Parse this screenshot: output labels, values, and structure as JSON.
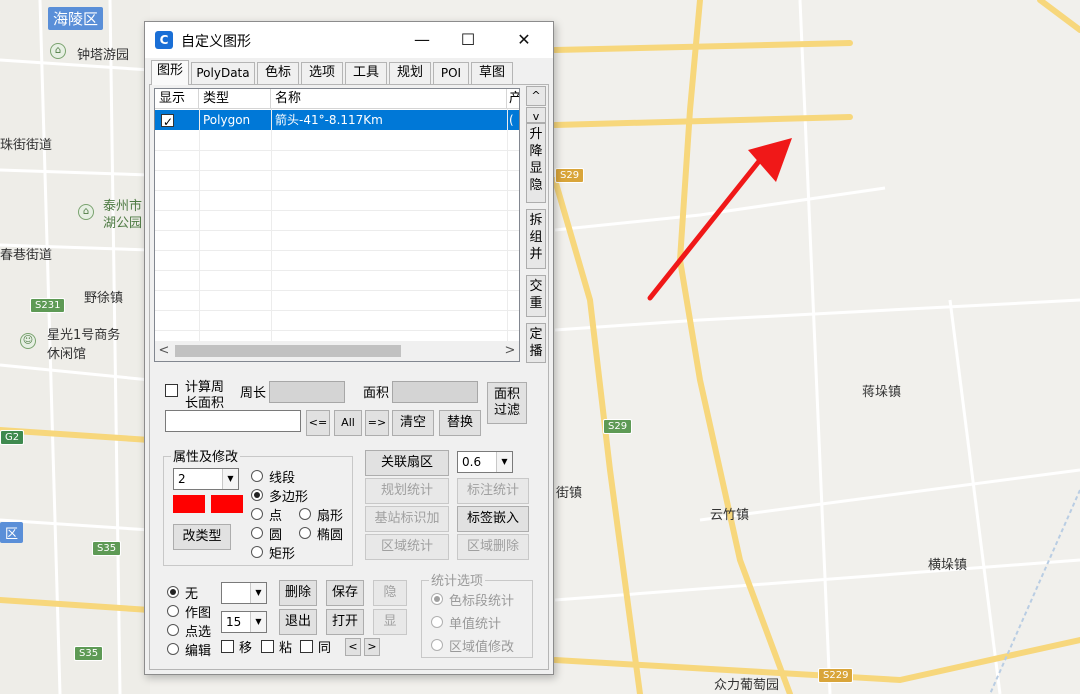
{
  "map": {
    "labels": {
      "haling": "海陵区",
      "tower_park": "钟塔游园",
      "zhujie": "珠街街道",
      "taizhou_park_a": "泰州市",
      "taizhou_park_b": "湖公园",
      "chunxiang": "春巷街道",
      "yexu": "野徐镇",
      "xingguang_a": "星光1号商务",
      "xingguang_b": "休闲馆",
      "jiangduo": "蒋垛镇",
      "yunzhu": "云竹镇",
      "hengduo": "横垛镇",
      "zhongli": "众力葡萄园",
      "town_fragment": "街镇",
      "qu": "区"
    },
    "shields": {
      "s231": "S231",
      "s29a": "S29",
      "s29b": "S29",
      "g2": "G2",
      "s35a": "S35",
      "s35b": "S35",
      "s229": "S229"
    },
    "colors": {
      "arrow": "#f01818",
      "road_yellow": "#f7d77c",
      "road_white": "#ffffff"
    }
  },
  "window": {
    "title": "自定义图形",
    "icon_text": "C",
    "controls": {
      "minimize": "—",
      "maximize": "☐",
      "close": "✕"
    },
    "tabs": [
      "图形",
      "PolyData",
      "色标",
      "选项",
      "工具",
      "规划",
      "POI",
      "草图"
    ],
    "active_tab": "图形",
    "list": {
      "columns": [
        "显示",
        "类型",
        "名称",
        "产"
      ],
      "rows": [
        {
          "checked": true,
          "type": "Polygon",
          "name": "箭头-41°-8.117Km",
          "extra": "("
        }
      ],
      "scroll_left": "<",
      "scroll_right": ">"
    },
    "side_buttons": {
      "up": "^",
      "down": "v",
      "sort": "升降显隐",
      "split": "拆组并",
      "intersect": "交重",
      "locate": "定播"
    },
    "calc": {
      "checkbox_label_1": "计算周",
      "checkbox_label_2": "长面积",
      "perimeter_label": "周长",
      "area_label": "面积",
      "area_filter_1": "面积",
      "area_filter_2": "过滤"
    },
    "search": {
      "value": "",
      "btn_prev": "<=",
      "btn_all": "All",
      "btn_next": "=>",
      "btn_clear": "清空",
      "btn_replace": "替换"
    },
    "attributes": {
      "group_title": "属性及修改",
      "width_value": "2",
      "shape_options": [
        "线段",
        "多边形",
        "点",
        "扇形",
        "圆",
        "椭圆",
        "矩形"
      ],
      "selected_shape": "多边形",
      "change_type": "改类型",
      "swatch_color": "#ff0000"
    },
    "tools": {
      "link_sector": "关联扇区",
      "opacity": "0.6",
      "plan_stats": "规划统计",
      "label_stats": "标注统计",
      "site_label_add": "基站标识加",
      "label_embed": "标签嵌入",
      "area_stats": "区域统计",
      "area_delete": "区域删除"
    },
    "modes": {
      "options": [
        "无",
        "作图",
        "点选",
        "编辑"
      ],
      "selected": "无",
      "combo_a": "",
      "combo_b": "15",
      "delete": "删除",
      "save": "保存",
      "hide": "隐",
      "exit": "退出",
      "open": "打开",
      "show": "显",
      "move": "移",
      "paste": "粘",
      "same": "同",
      "prev": "<",
      "next": ">"
    },
    "stats_options": {
      "title": "统计选项",
      "items": [
        "色标段统计",
        "单值统计",
        "区域值修改"
      ]
    }
  }
}
